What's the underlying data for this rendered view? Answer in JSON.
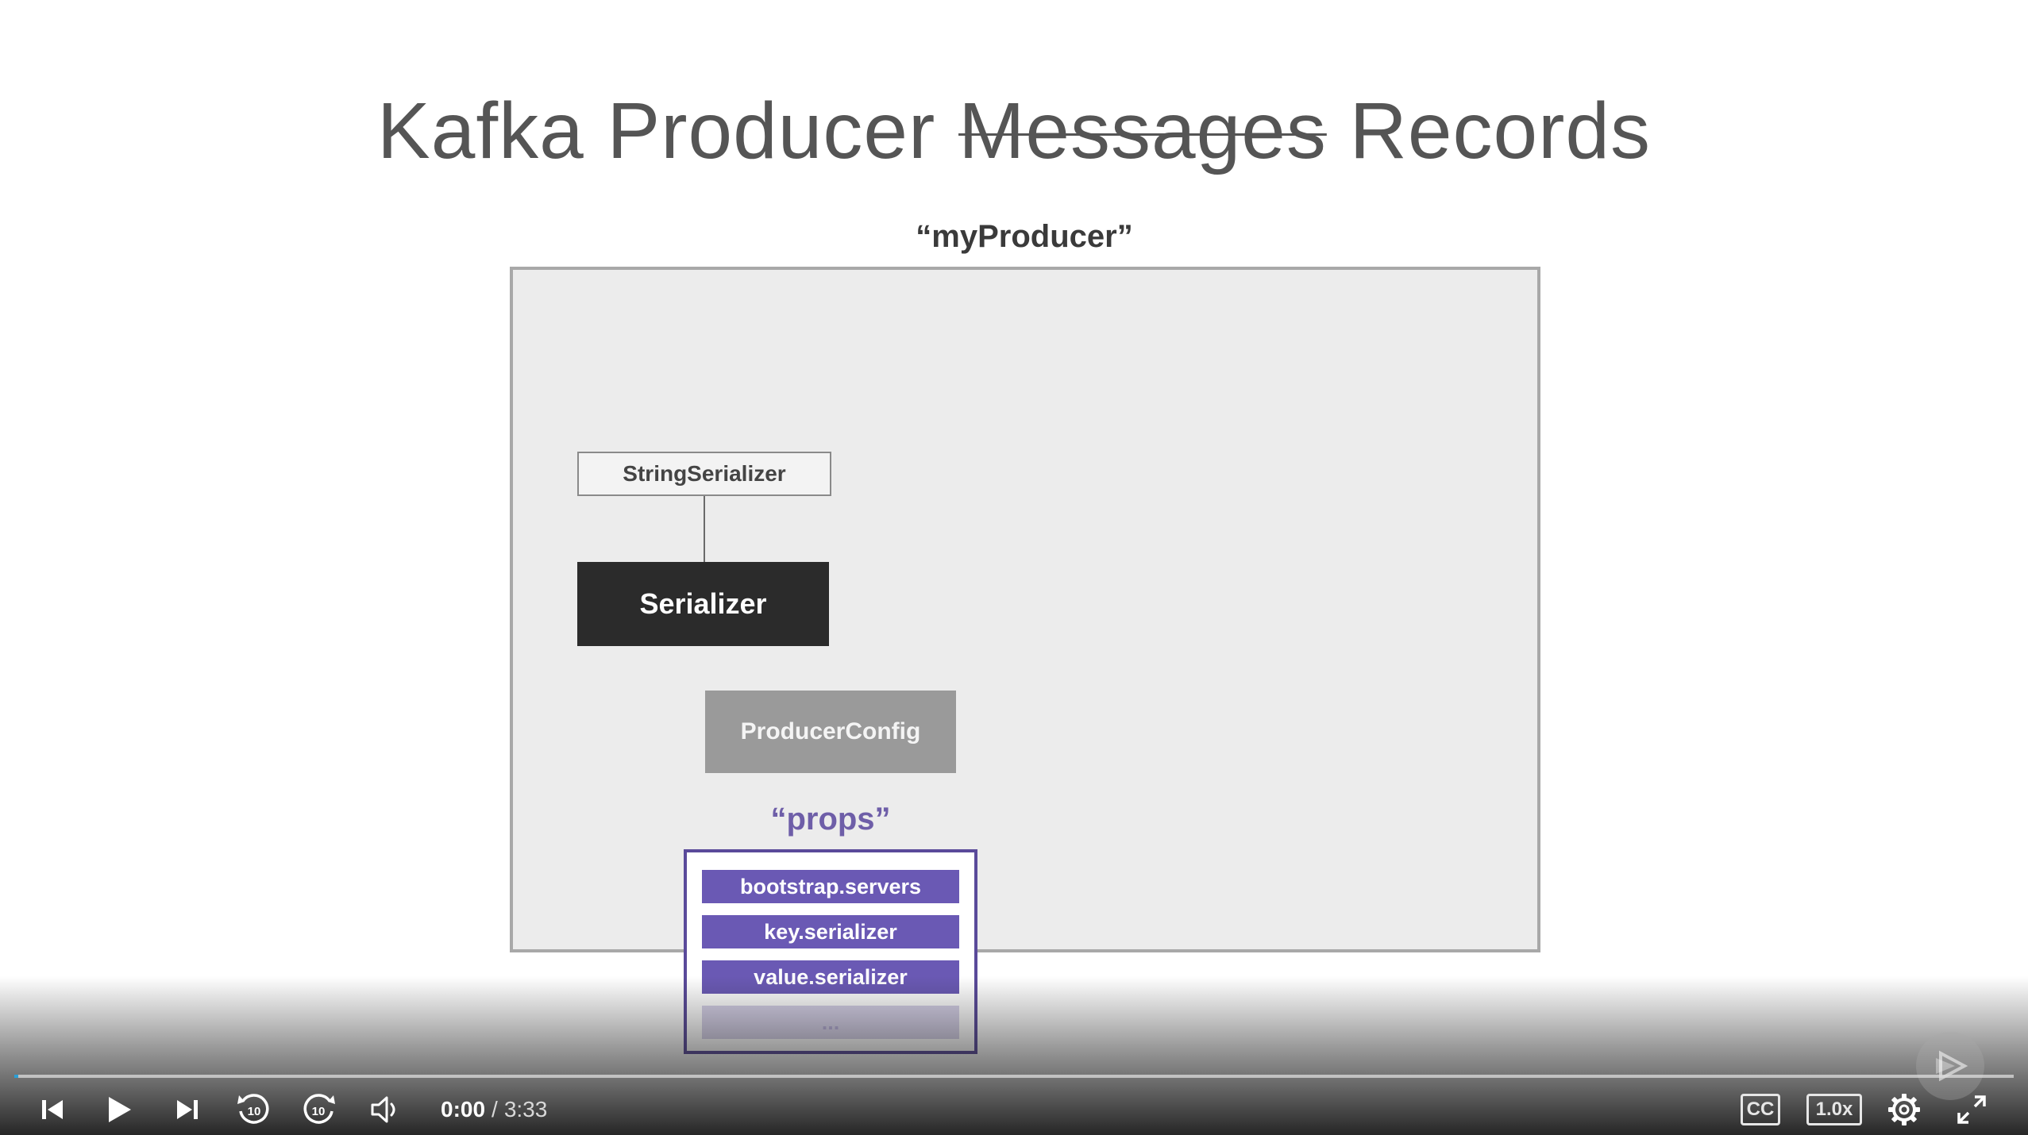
{
  "slide": {
    "title_part1": "Kafka Producer",
    "title_struck": "Messages",
    "title_part2": "Records",
    "producer_label": "“myProducer”",
    "string_serializer": "StringSerializer",
    "serializer": "Serializer",
    "producer_config": "ProducerConfig",
    "props_label": "“props”",
    "props_items": [
      "bootstrap.servers",
      "key.serializer",
      "value.serializer",
      "..."
    ]
  },
  "player": {
    "current_time": "0:00",
    "separator": "/",
    "duration": "3:33",
    "progress_fraction": 0.002,
    "cc_label": "CC",
    "speed_label": "1.0x",
    "accent_color": "#2a9fd6",
    "icons": {
      "previous": "skip-previous-icon",
      "play": "play-icon",
      "next": "skip-next-icon",
      "rewind": "rewind-10-icon",
      "forward": "forward-10-icon",
      "volume": "volume-icon",
      "settings": "gear-icon",
      "fullscreen": "fullscreen-icon",
      "watermark": "brand-play-icon"
    }
  }
}
